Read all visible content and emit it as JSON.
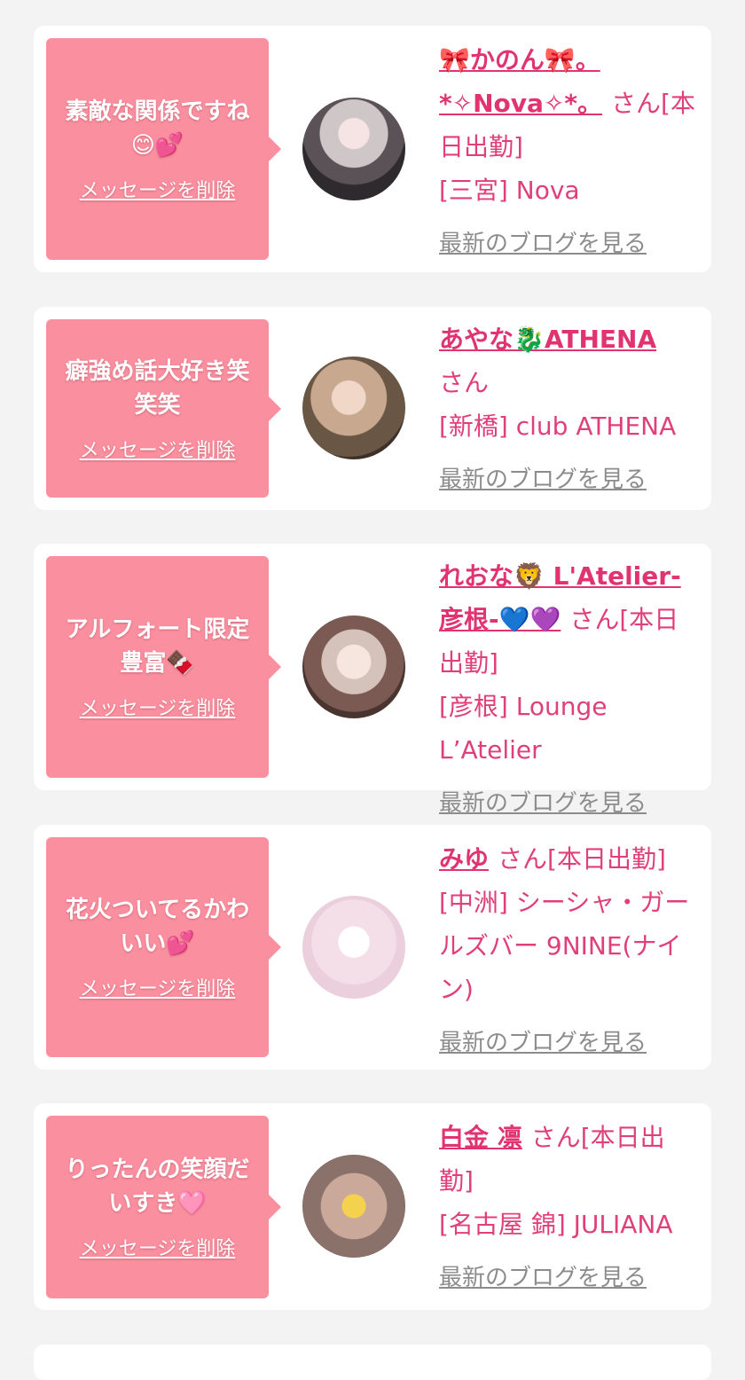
{
  "cards": [
    {
      "message": "素敵な関係ですね😊💕",
      "delete_label": "メッセージを削除",
      "name": "🎀かのん🎀。*✧Nova✧*。",
      "suffix": "さん[本日出勤]",
      "shop": "[三宮] Nova",
      "blog_label": "最新のブログを見る"
    },
    {
      "message": "癖強め話大好き笑笑笑",
      "delete_label": "メッセージを削除",
      "name": "あやな🐉ATHENA",
      "suffix": "さん",
      "shop": "[新橋] club ATHENA",
      "blog_label": "最新のブログを見る"
    },
    {
      "message": "アルフォート限定豊富🍫",
      "delete_label": "メッセージを削除",
      "name": "れおな🦁 L'Atelier-彦根-💙💜",
      "suffix": "さん[本日出勤]",
      "shop": "[彦根] Lounge L’Atelier",
      "blog_label": "最新のブログを見る"
    },
    {
      "message": "花火ついてるかわいい💕",
      "delete_label": "メッセージを削除",
      "name": "みゆ",
      "suffix": "さん[本日出勤]",
      "shop": "[中洲] シーシャ・ガールズバー 9NINE(ナイン)",
      "blog_label": "最新のブログを見る"
    },
    {
      "message": "りったんの笑顔だいすき🩷",
      "delete_label": "メッセージを削除",
      "name": "白金 凛",
      "suffix": "さん[本日出勤]",
      "shop": "[名古屋 錦] JULIANA",
      "blog_label": "最新のブログを見る"
    }
  ]
}
